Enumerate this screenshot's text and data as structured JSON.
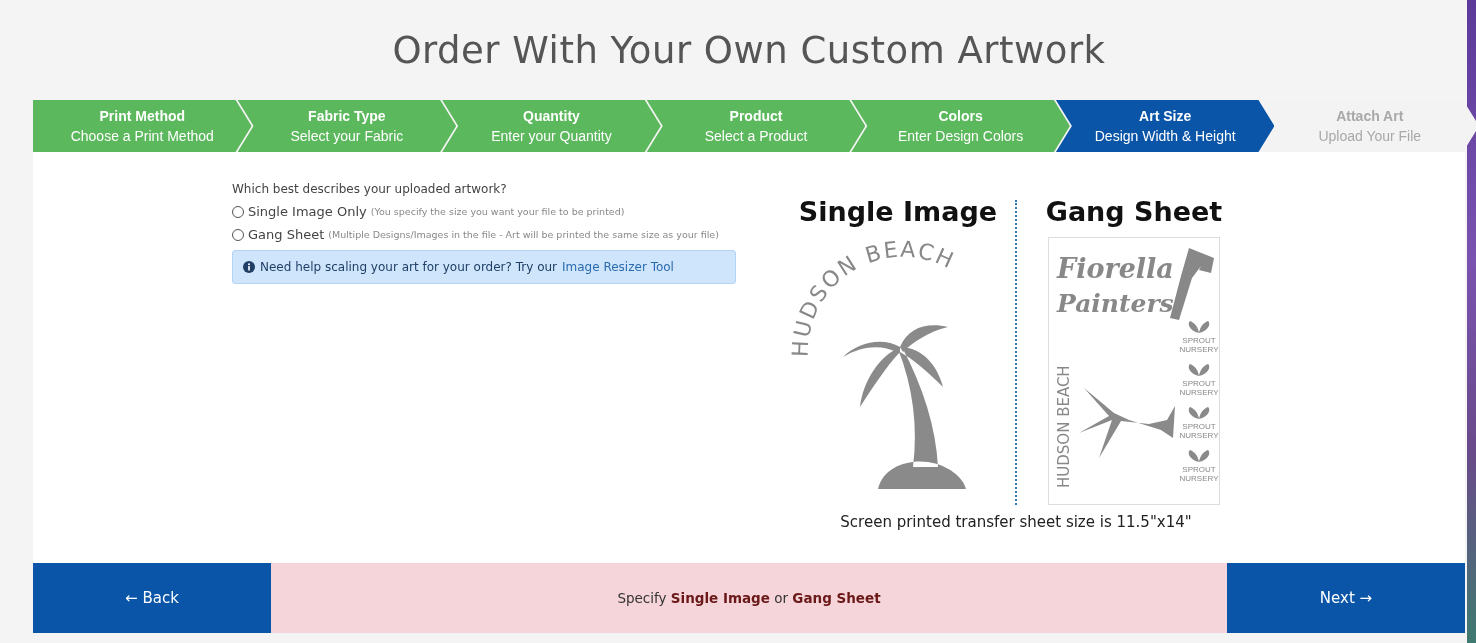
{
  "title": "Order With Your Own Custom Artwork",
  "steps": [
    {
      "title": "Print Method",
      "subtitle": "Choose a Print Method",
      "completed": true,
      "selected": false
    },
    {
      "title": "Fabric Type",
      "subtitle": "Select your Fabric",
      "completed": true,
      "selected": false
    },
    {
      "title": "Quantity",
      "subtitle": "Enter your Quantity",
      "completed": true,
      "selected": false
    },
    {
      "title": "Product",
      "subtitle": "Select a Product",
      "completed": true,
      "selected": false
    },
    {
      "title": "Colors",
      "subtitle": "Enter Design Colors",
      "completed": true,
      "selected": false
    },
    {
      "title": "Art Size",
      "subtitle": "Design Width & Height",
      "completed": false,
      "selected": true
    },
    {
      "title": "Attach Art",
      "subtitle": "Upload Your File",
      "completed": false,
      "selected": false
    }
  ],
  "question": "Which best describes your uploaded artwork?",
  "options": [
    {
      "label": "Single Image Only",
      "hint": "(You specify the size you want your file to be printed)",
      "selected": false
    },
    {
      "label": "Gang Sheet",
      "hint": "(Multiple Designs/Images in the file - Art will be printed the same size as your file)",
      "selected": false
    }
  ],
  "help": {
    "text": "Need help scaling your art for your order? Try our",
    "link": "Image Resizer Tool"
  },
  "illustration": {
    "left_heading": "Single Image",
    "right_heading": "Gang Sheet",
    "single_logo": "HUDSON BEACH",
    "gang_logo_line_1": "Fiorella",
    "gang_logo_line_2": "Painters",
    "gang_curved": "HUDSON BEACH",
    "sprouts": [
      {
        "line_1": "SPROUT",
        "line_2": "NURSERY"
      },
      {
        "line_1": "SPROUT",
        "line_2": "NURSERY"
      },
      {
        "line_1": "SPROUT",
        "line_2": "NURSERY"
      },
      {
        "line_1": "SPROUT",
        "line_2": "NURSERY"
      }
    ],
    "caption": "Screen printed transfer sheet size is 11.5\"x14\""
  },
  "footer": {
    "back": "← Back",
    "message": "Specify **Single Image** or **Gang Sheet**",
    "next": "Next →"
  }
}
